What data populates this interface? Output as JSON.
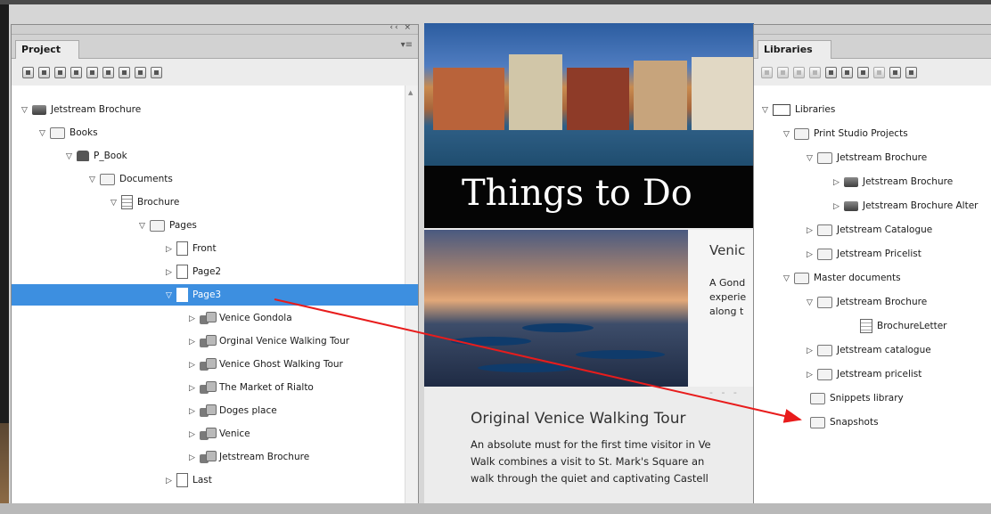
{
  "project_panel": {
    "collapse_controls": "‹‹  ×",
    "tab_label": "Project",
    "tab_menu": "▾≡",
    "tree": [
      {
        "label": "Jetstream Brochure",
        "icon": "book",
        "expanded": true
      },
      {
        "label": "Books",
        "icon": "folder",
        "expanded": true
      },
      {
        "label": "P_Book",
        "icon": "pbook",
        "expanded": true
      },
      {
        "label": "Documents",
        "icon": "folder",
        "expanded": true
      },
      {
        "label": "Brochure",
        "icon": "doc",
        "expanded": true
      },
      {
        "label": "Pages",
        "icon": "folder",
        "expanded": true
      },
      {
        "label": "Front",
        "icon": "page",
        "expanded": false
      },
      {
        "label": "Page2",
        "icon": "page",
        "expanded": false
      },
      {
        "label": "Page3",
        "icon": "page",
        "expanded": true,
        "selected": true
      },
      {
        "label": "Venice Gondola",
        "icon": "group",
        "expanded": false
      },
      {
        "label": "Orginal Venice Walking Tour",
        "icon": "group",
        "expanded": false
      },
      {
        "label": "Venice Ghost Walking Tour",
        "icon": "group",
        "expanded": false
      },
      {
        "label": "The Market of Rialto",
        "icon": "group",
        "expanded": false
      },
      {
        "label": "Doges place",
        "icon": "group",
        "expanded": false
      },
      {
        "label": "Venice",
        "icon": "group",
        "expanded": false
      },
      {
        "label": "Jetstream Brochure",
        "icon": "group",
        "expanded": false
      },
      {
        "label": "Last",
        "icon": "page",
        "expanded": false
      }
    ]
  },
  "document": {
    "headline": "Things to Do",
    "card_title": "Venic",
    "card_text_lines": [
      "A Gond",
      "experie",
      "along t"
    ],
    "dashes": "- - -",
    "section_title": "Original Venice Walking Tour",
    "section_lines": [
      "An absolute must for the first time visitor in Ve",
      "Walk combines a visit to St. Mark's Square an",
      "walk through the quiet and captivating Castell"
    ]
  },
  "libraries_panel": {
    "tab_label": "Libraries",
    "tree": [
      {
        "label": "Libraries",
        "icon": "lib",
        "expanded": true
      },
      {
        "label": "Print Studio Projects",
        "icon": "folder",
        "expanded": true
      },
      {
        "label": "Jetstream Brochure",
        "icon": "folder",
        "expanded": true
      },
      {
        "label": "Jetstream Brochure",
        "icon": "book",
        "expanded": false
      },
      {
        "label": "Jetstream Brochure Alter",
        "icon": "book",
        "expanded": false
      },
      {
        "label": "Jetstream Catalogue",
        "icon": "folder",
        "expanded": false
      },
      {
        "label": "Jetstream Pricelist",
        "icon": "folder",
        "expanded": false
      },
      {
        "label": "Master documents",
        "icon": "folder",
        "expanded": true
      },
      {
        "label": "Jetstream Brochure",
        "icon": "folder",
        "expanded": true
      },
      {
        "label": "BrochureLetter",
        "icon": "snip",
        "expanded": null
      },
      {
        "label": "Jetstream catalogue",
        "icon": "folder",
        "expanded": false
      },
      {
        "label": "Jetstream pricelist",
        "icon": "folder",
        "expanded": false
      },
      {
        "label": "Snippets library",
        "icon": "folder",
        "expanded": null
      },
      {
        "label": "Snapshots",
        "icon": "folder",
        "expanded": null
      }
    ]
  },
  "colors": {
    "selection": "#3d8fe0",
    "drag_arrow": "#e81c1c",
    "panel_bg": "#ececec",
    "headline_band": "#050505"
  }
}
